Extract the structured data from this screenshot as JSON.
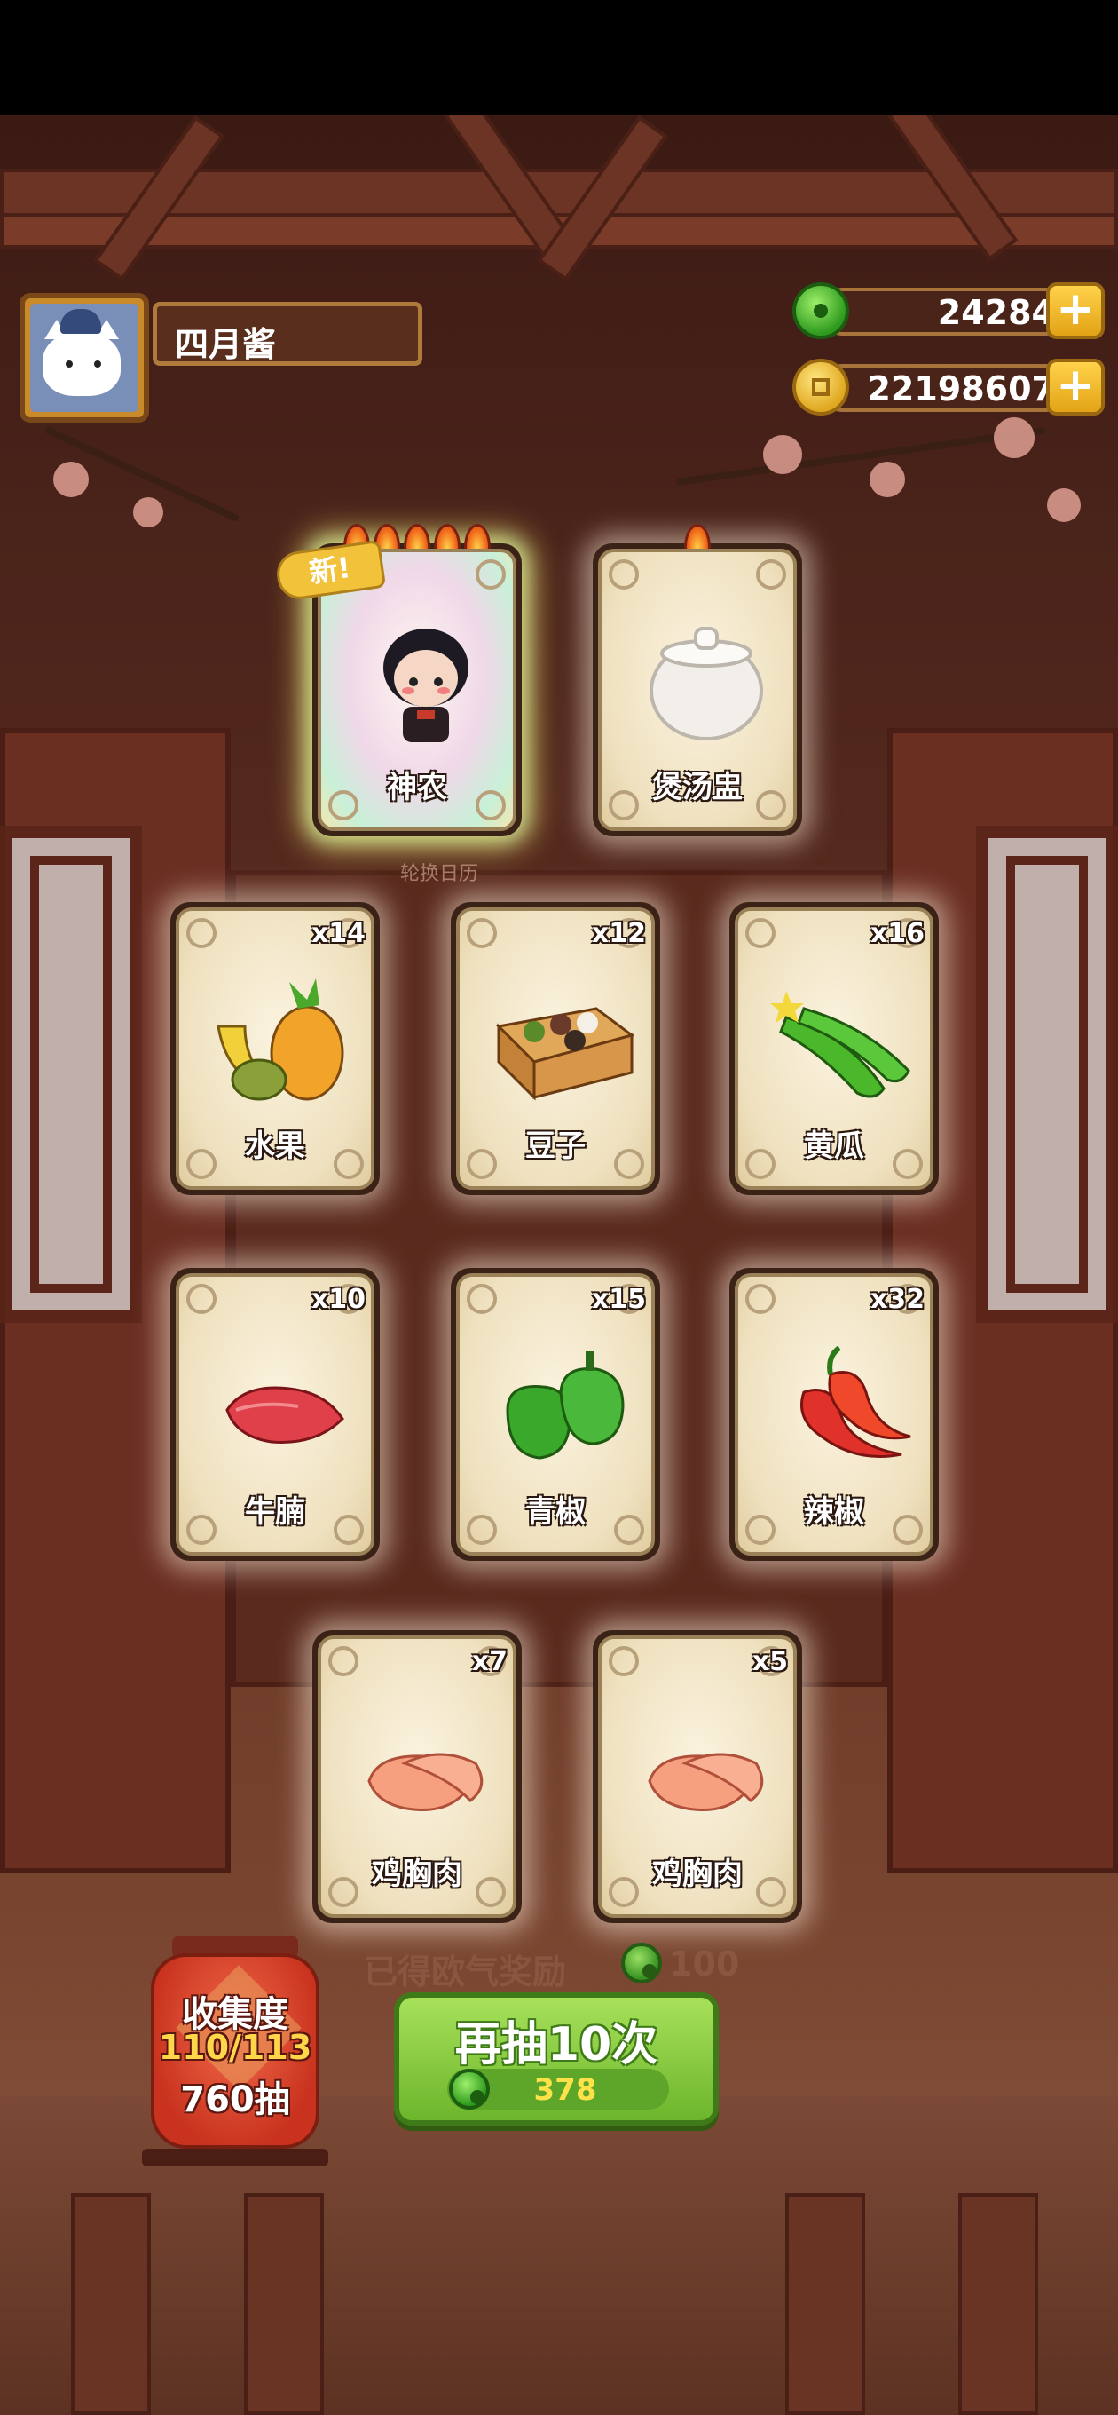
{
  "player": {
    "name": "四月酱"
  },
  "currencies": [
    {
      "type": "jade",
      "value": "24284",
      "icon": "jade-icon"
    },
    {
      "type": "coin",
      "value": "22198607",
      "icon": "coin-icon"
    }
  ],
  "top_cards": [
    {
      "label": "神农",
      "flames": 5,
      "new_tag": "新!",
      "art": "chibi-character"
    },
    {
      "label": "煲汤盅",
      "flames": 1,
      "art": "soup-pot"
    }
  ],
  "calendar_label": "轮换日历",
  "item_cards": [
    {
      "label": "水果",
      "count": "x14",
      "art": "fruit"
    },
    {
      "label": "豆子",
      "count": "x12",
      "art": "beans-box"
    },
    {
      "label": "黄瓜",
      "count": "x16",
      "art": "cucumber"
    },
    {
      "label": "牛腩",
      "count": "x10",
      "art": "beef"
    },
    {
      "label": "青椒",
      "count": "x15",
      "art": "green-pepper"
    },
    {
      "label": "辣椒",
      "count": "x32",
      "art": "chili"
    },
    {
      "label": "鸡胸肉",
      "count": "x7",
      "art": "chicken-breast"
    },
    {
      "label": "鸡胸肉",
      "count": "x5",
      "art": "chicken-breast"
    }
  ],
  "reward": {
    "text": "已得欧气奖励",
    "value": "100"
  },
  "collection": {
    "title": "收集度",
    "progress": "110/113",
    "draws": "760抽"
  },
  "draw_button": {
    "label": "再抽10次",
    "cost": "378"
  }
}
